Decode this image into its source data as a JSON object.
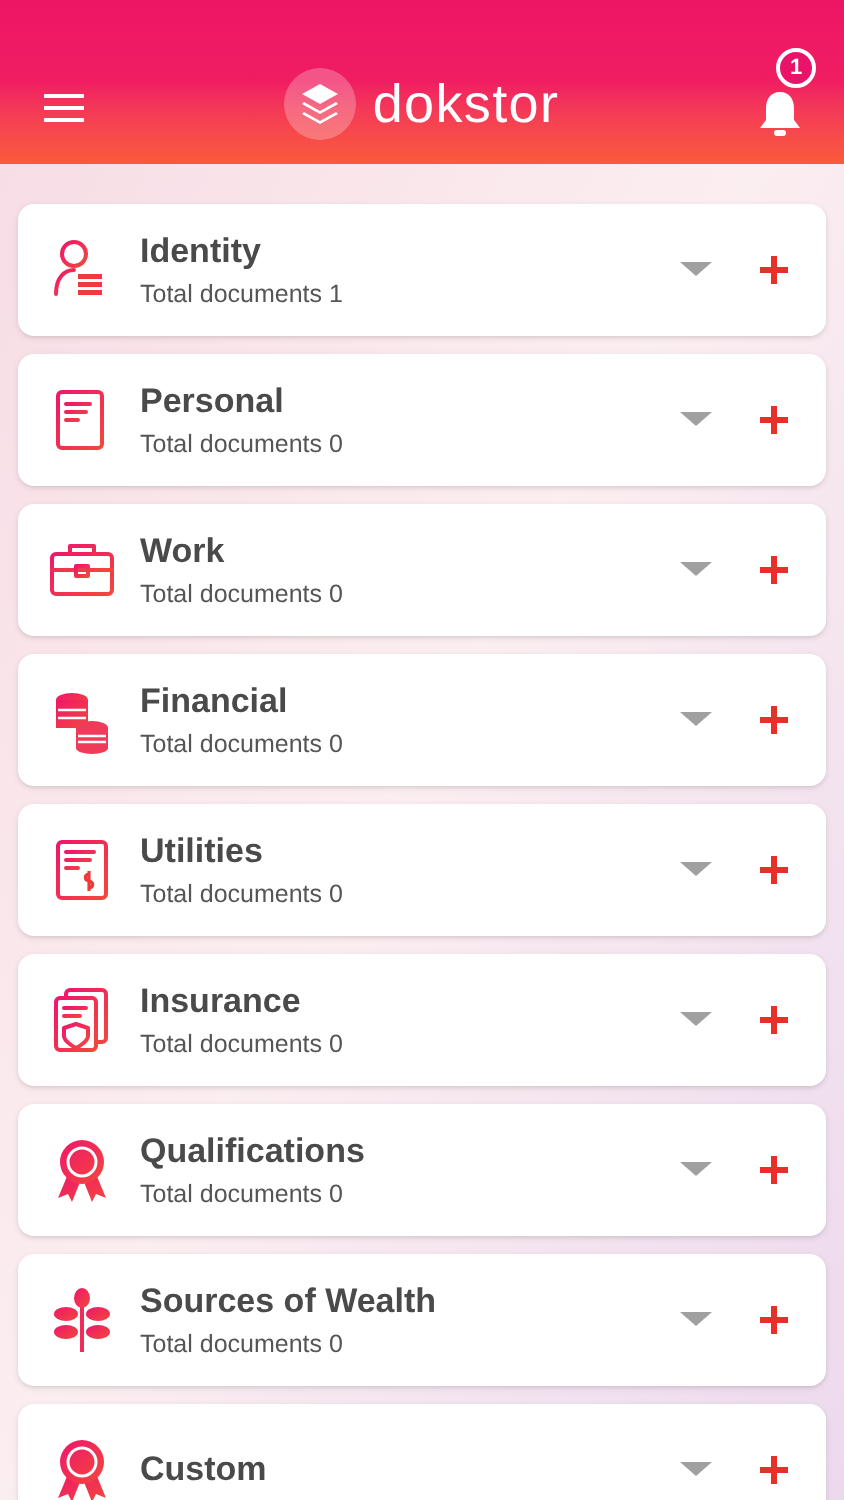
{
  "app_bar": {
    "logo_text": "dokstor",
    "notification_count": "1"
  },
  "categories": [
    {
      "kind": "identity",
      "title": "Identity",
      "subtitle": "Total documents 1"
    },
    {
      "kind": "personal",
      "title": "Personal",
      "subtitle": "Total documents 0"
    },
    {
      "kind": "work",
      "title": "Work",
      "subtitle": "Total documents 0"
    },
    {
      "kind": "financial",
      "title": "Financial",
      "subtitle": "Total documents 0"
    },
    {
      "kind": "utilities",
      "title": "Utilities",
      "subtitle": "Total documents 0"
    },
    {
      "kind": "insurance",
      "title": "Insurance",
      "subtitle": "Total documents 0"
    },
    {
      "kind": "qualifications",
      "title": "Qualifications",
      "subtitle": "Total documents 0"
    },
    {
      "kind": "wealth",
      "title": "Sources of Wealth",
      "subtitle": "Total documents 0"
    },
    {
      "kind": "custom",
      "title": "Custom"
    }
  ]
}
